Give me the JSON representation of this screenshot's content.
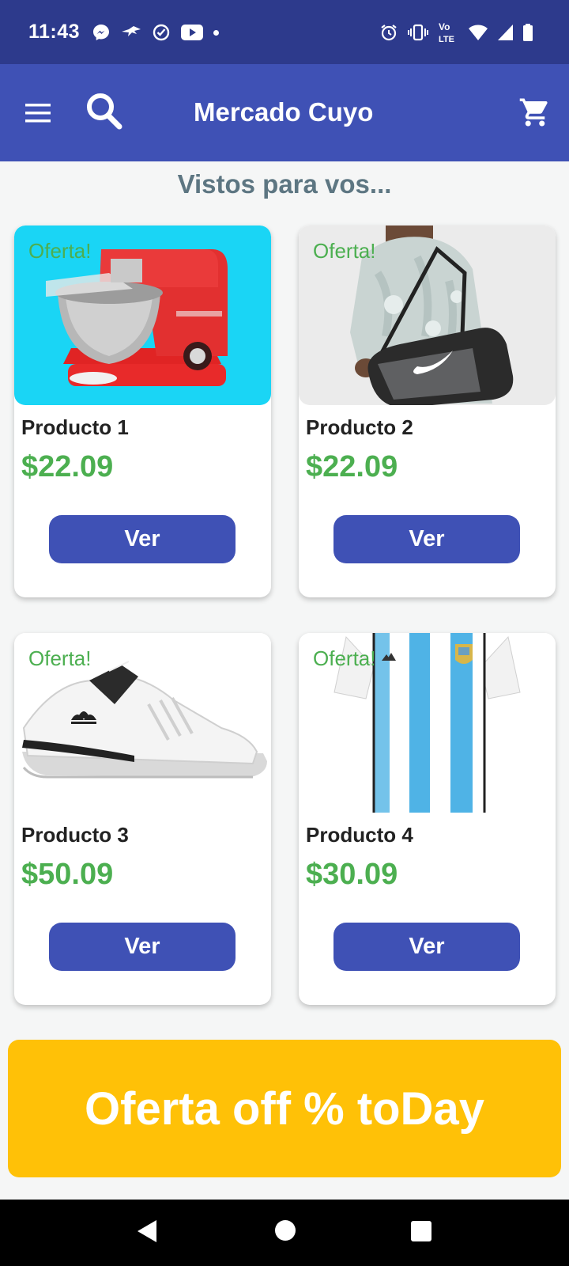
{
  "status_bar": {
    "time": "11:43",
    "left_icons": [
      "messenger-icon",
      "bird-app-icon",
      "check-circle-icon",
      "youtube-icon",
      "dot-icon"
    ],
    "right_icons": [
      "alarm-icon",
      "vibrate-icon",
      "volte-icon",
      "wifi-icon",
      "signal-icon",
      "battery-icon"
    ],
    "volte_label_top": "Vo",
    "volte_label_bottom": "LTE"
  },
  "app_bar": {
    "title": "Mercado Cuyo",
    "background": "#3f51b5",
    "status_background": "#2d3a8c"
  },
  "section_title": "Vistos para vos...",
  "products": [
    {
      "badge": "Oferta!",
      "name": "Producto 1",
      "price": "$22.09",
      "button": "Ver",
      "image": "stand-mixer"
    },
    {
      "badge": "Oferta!",
      "name": "Producto 2",
      "price": "$22.09",
      "button": "Ver",
      "image": "duffel-bag"
    },
    {
      "badge": "Oferta!",
      "name": "Producto 3",
      "price": "$50.09",
      "button": "Ver",
      "image": "sneaker"
    },
    {
      "badge": "Oferta!",
      "name": "Producto 4",
      "price": "$30.09",
      "button": "Ver",
      "image": "football-jersey"
    }
  ],
  "banner": {
    "text": "Oferta off % toDay",
    "color": "#ffc107"
  },
  "colors": {
    "accent": "#3f51b5",
    "price": "#4caf50",
    "badge": "#4caf50",
    "section_title": "#5d7682"
  },
  "nav_bar": {
    "icons": [
      "back-icon",
      "home-icon",
      "recents-icon"
    ]
  }
}
